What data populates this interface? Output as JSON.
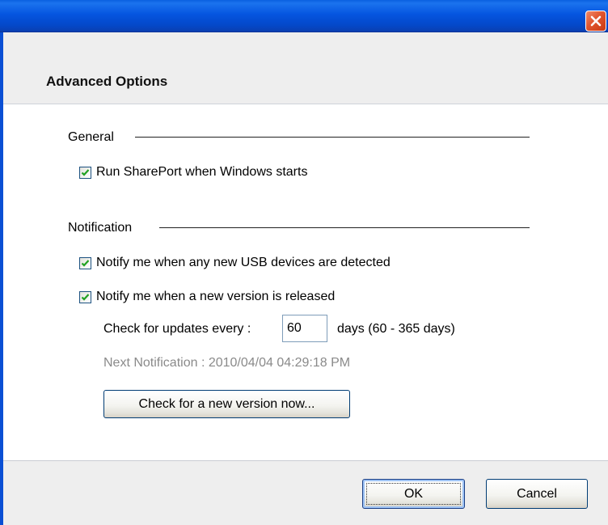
{
  "window": {
    "title": ""
  },
  "header": {
    "title": "Advanced Options"
  },
  "general": {
    "heading": "General",
    "run_on_startup": {
      "label": "Run SharePort when Windows starts",
      "checked": true
    }
  },
  "notification": {
    "heading": "Notification",
    "notify_usb": {
      "label": "Notify me when any new USB devices are detected",
      "checked": true
    },
    "notify_version": {
      "label": "Notify me when a new version is released",
      "checked": true
    },
    "check_every_label": "Check for updates every :",
    "days_value": "60",
    "days_range_label": "days (60 - 365 days)",
    "next_notification": "Next Notification : 2010/04/04 04:29:18 PM",
    "check_now_label": "Check for a new version now..."
  },
  "footer": {
    "ok_label": "OK",
    "cancel_label": "Cancel"
  },
  "colors": {
    "titlebar": "#0555e0",
    "close": "#e0552e",
    "panel": "#eeeeee"
  }
}
